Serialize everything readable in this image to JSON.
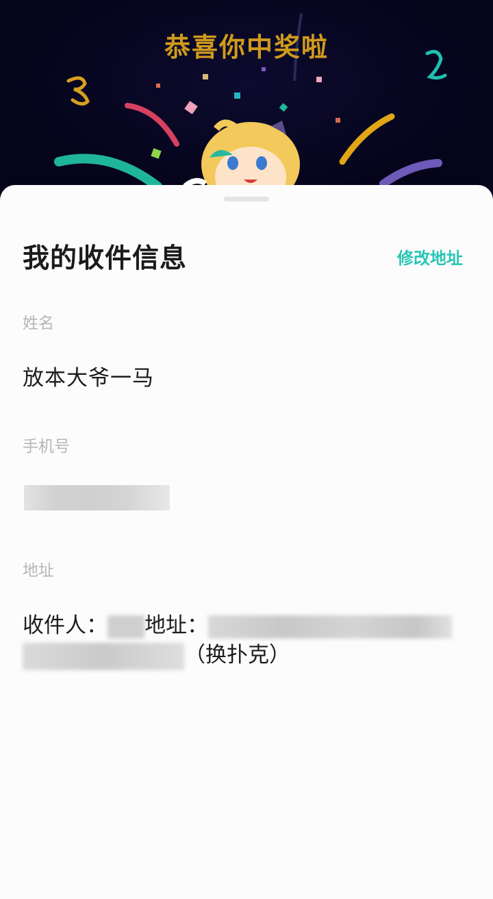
{
  "banner": {
    "title": "恭喜你中奖啦",
    "title_color": "#d09a1c",
    "background_color": "#05041a",
    "illustration": "confetti-and-mascot-girl"
  },
  "sheet": {
    "title": "我的收件信息",
    "edit_address_label": "修改地址",
    "accent_color": "#27c6b4",
    "fields": [
      {
        "label": "姓名",
        "value": "放本大爷一马"
      },
      {
        "label": "手机号",
        "value": ""
      },
      {
        "label": "地址",
        "value": ""
      }
    ],
    "address": {
      "recipient_label": "收件人：",
      "address_label": "地址：",
      "suffix": "（换扑克）"
    }
  }
}
